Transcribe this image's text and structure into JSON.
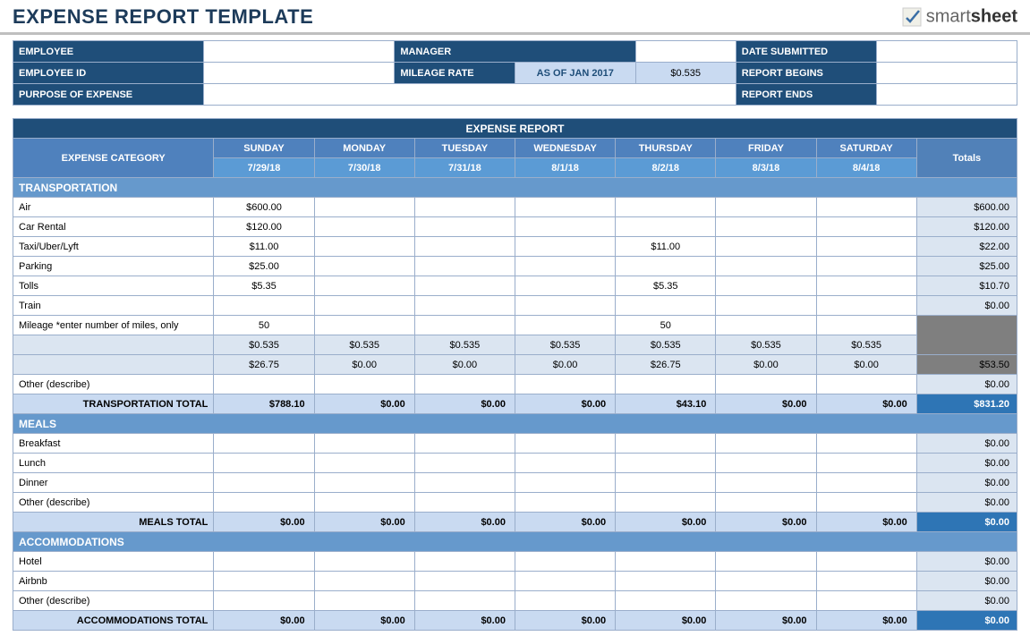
{
  "title": "EXPENSE REPORT TEMPLATE",
  "logo": {
    "brand": "smart",
    "bold": "sheet"
  },
  "info": {
    "employee_label": "EMPLOYEE",
    "employee": "",
    "manager_label": "MANAGER",
    "manager": "",
    "date_submitted_label": "DATE SUBMITTED",
    "date_submitted": "",
    "employee_id_label": "EMPLOYEE ID",
    "employee_id": "",
    "mileage_rate_label": "MILEAGE RATE",
    "mileage_asof": "AS OF JAN 2017",
    "mileage_rate": "$0.535",
    "report_begins_label": "REPORT BEGINS",
    "report_begins": "",
    "purpose_label": "PURPOSE OF EXPENSE",
    "purpose": "",
    "report_ends_label": "REPORT ENDS",
    "report_ends": ""
  },
  "report": {
    "header": "EXPENSE REPORT",
    "category_label": "EXPENSE CATEGORY",
    "totals_label": "Totals",
    "days": [
      "SUNDAY",
      "MONDAY",
      "TUESDAY",
      "WEDNESDAY",
      "THURSDAY",
      "FRIDAY",
      "SATURDAY"
    ],
    "dates": [
      "7/29/18",
      "7/30/18",
      "7/31/18",
      "8/1/18",
      "8/2/18",
      "8/3/18",
      "8/4/18"
    ],
    "sections": {
      "transportation": {
        "title": "TRANSPORTATION",
        "rows": [
          {
            "name": "Air",
            "v": [
              "$600.00",
              "",
              "",
              "",
              "",
              "",
              ""
            ],
            "t": "$600.00"
          },
          {
            "name": "Car Rental",
            "v": [
              "$120.00",
              "",
              "",
              "",
              "",
              "",
              ""
            ],
            "t": "$120.00"
          },
          {
            "name": "Taxi/Uber/Lyft",
            "v": [
              "$11.00",
              "",
              "",
              "",
              "$11.00",
              "",
              ""
            ],
            "t": "$22.00"
          },
          {
            "name": "Parking",
            "v": [
              "$25.00",
              "",
              "",
              "",
              "",
              "",
              ""
            ],
            "t": "$25.00"
          },
          {
            "name": "Tolls",
            "v": [
              "$5.35",
              "",
              "",
              "",
              "$5.35",
              "",
              ""
            ],
            "t": "$10.70"
          },
          {
            "name": "Train",
            "v": [
              "",
              "",
              "",
              "",
              "",
              "",
              ""
            ],
            "t": "$0.00"
          }
        ],
        "mileage_label": "Mileage *enter number of miles, only",
        "mileage": [
          "50",
          "",
          "",
          "",
          "50",
          "",
          ""
        ],
        "rate": [
          "$0.535",
          "$0.535",
          "$0.535",
          "$0.535",
          "$0.535",
          "$0.535",
          "$0.535"
        ],
        "mileage_cost": [
          "$26.75",
          "$0.00",
          "$0.00",
          "$0.00",
          "$26.75",
          "$0.00",
          "$0.00"
        ],
        "mileage_total": "$53.50",
        "other": {
          "name": "Other (describe)",
          "v": [
            "",
            "",
            "",
            "",
            "",
            "",
            ""
          ],
          "t": "$0.00"
        },
        "subtotal_label": "TRANSPORTATION TOTAL",
        "subtotal": [
          "$788.10",
          "$0.00",
          "$0.00",
          "$0.00",
          "$43.10",
          "$0.00",
          "$0.00"
        ],
        "subtotal_total": "$831.20"
      },
      "meals": {
        "title": "MEALS",
        "rows": [
          {
            "name": "Breakfast",
            "v": [
              "",
              "",
              "",
              "",
              "",
              "",
              ""
            ],
            "t": "$0.00"
          },
          {
            "name": "Lunch",
            "v": [
              "",
              "",
              "",
              "",
              "",
              "",
              ""
            ],
            "t": "$0.00"
          },
          {
            "name": "Dinner",
            "v": [
              "",
              "",
              "",
              "",
              "",
              "",
              ""
            ],
            "t": "$0.00"
          },
          {
            "name": "Other (describe)",
            "v": [
              "",
              "",
              "",
              "",
              "",
              "",
              ""
            ],
            "t": "$0.00"
          }
        ],
        "subtotal_label": "MEALS TOTAL",
        "subtotal": [
          "$0.00",
          "$0.00",
          "$0.00",
          "$0.00",
          "$0.00",
          "$0.00",
          "$0.00"
        ],
        "subtotal_total": "$0.00"
      },
      "accommodations": {
        "title": "ACCOMMODATIONS",
        "rows": [
          {
            "name": "Hotel",
            "v": [
              "",
              "",
              "",
              "",
              "",
              "",
              ""
            ],
            "t": "$0.00"
          },
          {
            "name": "Airbnb",
            "v": [
              "",
              "",
              "",
              "",
              "",
              "",
              ""
            ],
            "t": "$0.00"
          },
          {
            "name": "Other (describe)",
            "v": [
              "",
              "",
              "",
              "",
              "",
              "",
              ""
            ],
            "t": "$0.00"
          }
        ],
        "subtotal_label": "ACCOMMODATIONS TOTAL",
        "subtotal": [
          "$0.00",
          "$0.00",
          "$0.00",
          "$0.00",
          "$0.00",
          "$0.00",
          "$0.00"
        ],
        "subtotal_total": "$0.00"
      }
    }
  }
}
